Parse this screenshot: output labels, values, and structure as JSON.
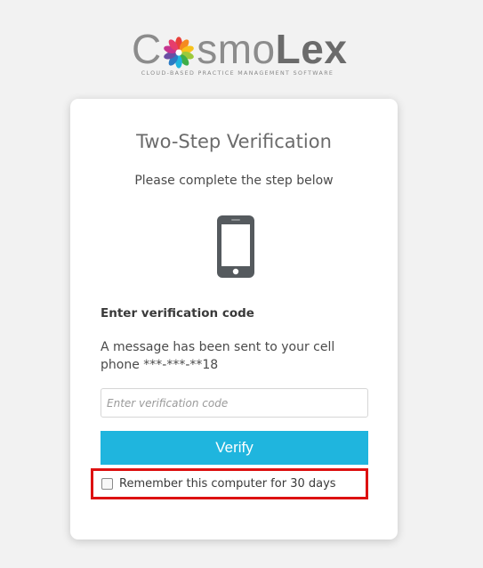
{
  "brand": {
    "logo_prefix": "C",
    "logo_middle": "smo",
    "logo_suffix": "Lex",
    "tagline": "CLOUD-BASED PRACTICE MANAGEMENT SOFTWARE",
    "logo_icon": "flower-icon"
  },
  "card": {
    "title": "Two-Step Verification",
    "subtitle": "Please complete the step below",
    "device_icon": "mobile-phone-icon",
    "code_label": "Enter verification code",
    "message": "A message has been sent to your cell phone ***-***-**18",
    "input": {
      "value": "",
      "placeholder": "Enter verification code"
    },
    "verify_label": "Verify",
    "remember": {
      "label": "Remember this computer for 30 days",
      "checked": false
    }
  },
  "colors": {
    "accent": "#1fb5de",
    "highlight_border": "#dd1111",
    "background": "#f2f2f2"
  }
}
